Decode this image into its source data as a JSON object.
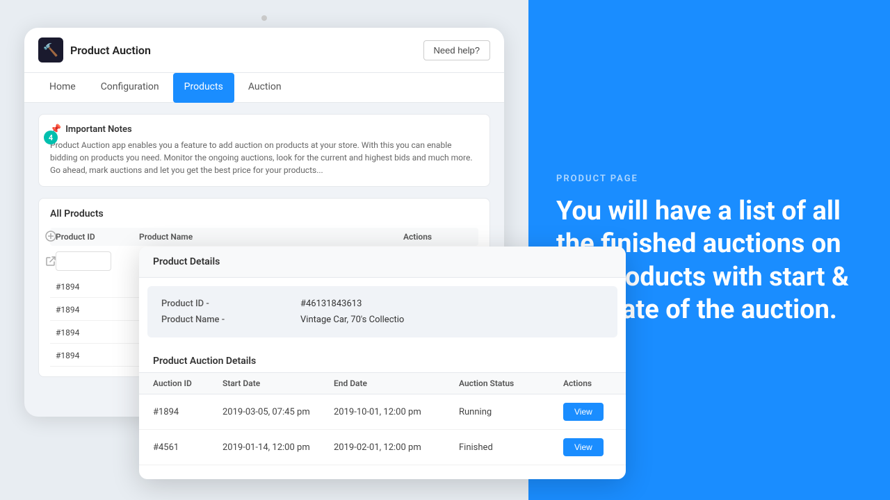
{
  "rightPanel": {
    "label": "PRODUCT PAGE",
    "heading": "You will have a list of all the finished auctions on the products with start & end date of the auction."
  },
  "app": {
    "title": "Product Auction",
    "logoIcon": "🔨",
    "needHelpLabel": "Need help?"
  },
  "nav": {
    "items": [
      {
        "label": "Home",
        "active": false
      },
      {
        "label": "Configuration",
        "active": false
      },
      {
        "label": "Products",
        "active": true
      },
      {
        "label": "Auction",
        "active": false
      }
    ]
  },
  "badge": {
    "count": "4"
  },
  "notesBox": {
    "icon": "📌",
    "title": "Important Notes",
    "text": "Product Auction app enables you a feature to add auction on products at your store. With this you can enable bidding on products you need. Monitor the ongoing auctions, look for the current and highest bids and much more. Go ahead, mark auctions and let you get the best price for your products..."
  },
  "allProducts": {
    "sectionTitle": "All Products",
    "columns": [
      "Product ID",
      "Product Name",
      "Actions"
    ],
    "rows": [
      {
        "id": "#1894",
        "name": "",
        "actions": ""
      },
      {
        "id": "#1894",
        "name": "",
        "actions": ""
      },
      {
        "id": "#1894",
        "name": "",
        "actions": ""
      },
      {
        "id": "#1894",
        "name": "",
        "actions": ""
      }
    ]
  },
  "modal": {
    "productDetailsTitle": "Product Details",
    "productIdLabel": "Product ID -",
    "productIdValue": "#46131843613",
    "productNameLabel": "Product Name -",
    "productNameValue": "Vintage Car, 70's Collectio",
    "auctionDetailsTitle": "Product Auction Details",
    "auctionTableColumns": [
      "Auction ID",
      "Start Date",
      "End Date",
      "Auction Status",
      "Actions"
    ],
    "auctionRows": [
      {
        "id": "#1894",
        "startDate": "2019-03-05, 07:45 pm",
        "endDate": "2019-10-01, 12:00 pm",
        "status": "Running",
        "actionLabel": "View"
      },
      {
        "id": "#4561",
        "startDate": "2019-01-14, 12:00 pm",
        "endDate": "2019-02-01, 12:00 pm",
        "status": "Finished",
        "actionLabel": "View"
      }
    ]
  }
}
